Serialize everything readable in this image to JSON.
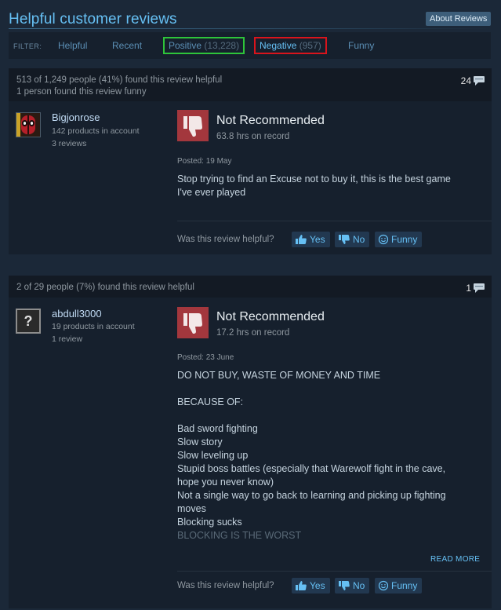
{
  "header": {
    "title": "Helpful customer reviews",
    "about_label": "About Reviews"
  },
  "filter": {
    "label": "FILTER:",
    "tabs": [
      {
        "label": "Helpful",
        "count": ""
      },
      {
        "label": "Recent",
        "count": ""
      },
      {
        "label": "Positive",
        "count": "(13,228)"
      },
      {
        "label": "Negative",
        "count": "(957)"
      },
      {
        "label": "Funny",
        "count": ""
      }
    ]
  },
  "reviews": [
    {
      "helpful": "513 of 1,249 people (41%) found this review helpful",
      "funny": "1 person found this review funny",
      "comments": "24",
      "user": {
        "name": "Bigjonrose",
        "products": "142 products in account",
        "reviews": "3 reviews"
      },
      "verdict": "Not Recommended",
      "hours": "63.8 hrs on record",
      "posted": "Posted: 19 May",
      "lines": [
        "Stop trying to find an Excuse not to buy it, this is the best game",
        "I've ever played"
      ],
      "vote": {
        "question": "Was this review helpful?",
        "yes": "Yes",
        "no": "No",
        "funny": "Funny"
      }
    },
    {
      "helpful": "2 of 29 people (7%) found this review helpful",
      "comments": "1",
      "user": {
        "name": "abdull3000",
        "products": "19 products in account",
        "reviews": "1 review",
        "avatar_glyph": "?"
      },
      "verdict": "Not Recommended",
      "hours": "17.2 hrs on record",
      "posted": "Posted: 23 June",
      "lines": [
        "DO NOT BUY, WASTE OF MONEY AND TIME",
        "",
        "BECAUSE OF:",
        "",
        "Bad sword fighting",
        "Slow story",
        "Slow leveling up",
        "Stupid boss battles (especially that Warewolf fight in the cave,",
        "hope you never know)",
        "Not a single way to go back to learning and picking up fighting",
        "moves",
        "Blocking sucks",
        "BLOCKING IS THE WORST"
      ],
      "read_more": "READ MORE",
      "vote": {
        "question": "Was this review helpful?",
        "yes": "Yes",
        "no": "No",
        "funny": "Funny"
      }
    }
  ],
  "colors": {
    "accent": "#66c0f4",
    "thumb_down_bg": "#a3373d",
    "positive_outline": "#2ec43a",
    "negative_outline": "#d9141c"
  }
}
